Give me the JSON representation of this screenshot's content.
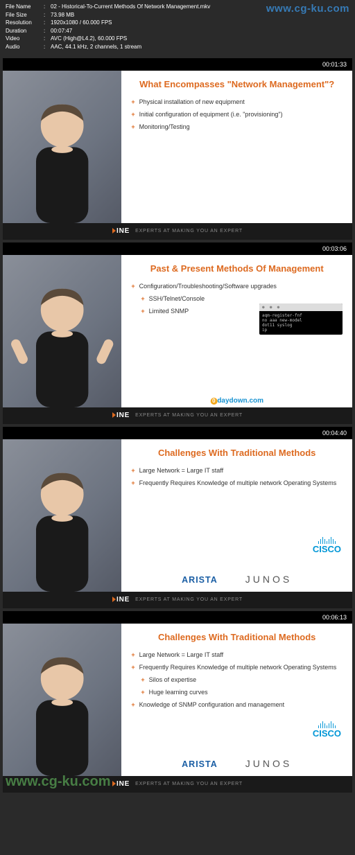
{
  "watermarks": {
    "top": "www.cg-ku.com",
    "bottom": "www.cg-ku.com",
    "zeroday": "0daydown.com"
  },
  "meta": {
    "labels": {
      "filename": "File Name",
      "filesize": "File Size",
      "resolution": "Resolution",
      "duration": "Duration",
      "video": "Video",
      "audio": "Audio"
    },
    "filename": "02 - Historical-To-Current Methods Of Network Management.mkv",
    "filesize": "73.98 MB",
    "resolution": "1920x1080 / 60.000 FPS",
    "duration": "00:07:47",
    "video": "AVC (High@L4.2), 60.000 FPS",
    "audio": "AAC, 44.1 kHz, 2 channels, 1 stream"
  },
  "footer": {
    "ine": "INE",
    "tagline": "EXPERTS AT MAKING YOU AN EXPERT"
  },
  "logos": {
    "arista": "ARISTA",
    "cisco": "CISCO",
    "junos": "JUNOS"
  },
  "frames": [
    {
      "time": "00:01:33",
      "title": "What Encompasses \"Network Management\"?",
      "bullets": [
        {
          "text": "Physical installation of new equipment",
          "sub": false
        },
        {
          "text": "Initial configuration of equipment (i.e. \"provisioning\")",
          "sub": false
        },
        {
          "text": "Monitoring/Testing",
          "sub": false
        }
      ]
    },
    {
      "time": "00:03:06",
      "title": "Past & Present Methods Of Management",
      "bullets": [
        {
          "text": "Configuration/Troubleshooting/Software upgrades",
          "sub": false
        },
        {
          "text": "SSH/Telnet/Console",
          "sub": true
        },
        {
          "text": "Limited SNMP",
          "sub": true
        }
      ],
      "terminal": "aqm-register-fnf\nno aaa new-model\ndot11 syslog\nip\n"
    },
    {
      "time": "00:04:40",
      "title": "Challenges With Traditional Methods",
      "bullets": [
        {
          "text": "Large Network = Large IT staff",
          "sub": false
        },
        {
          "text": "Frequently Requires Knowledge of multiple network Operating Systems",
          "sub": false
        }
      ],
      "show_logos": true
    },
    {
      "time": "00:06:13",
      "title": "Challenges With Traditional Methods",
      "bullets": [
        {
          "text": "Large Network = Large IT staff",
          "sub": false
        },
        {
          "text": "Frequently Requires Knowledge of multiple network Operating Systems",
          "sub": false
        },
        {
          "text": "Silos of expertise",
          "sub": true
        },
        {
          "text": "Huge learning curves",
          "sub": true
        },
        {
          "text": "Knowledge of SNMP configuration and management",
          "sub": false
        }
      ],
      "show_logos": true
    }
  ]
}
